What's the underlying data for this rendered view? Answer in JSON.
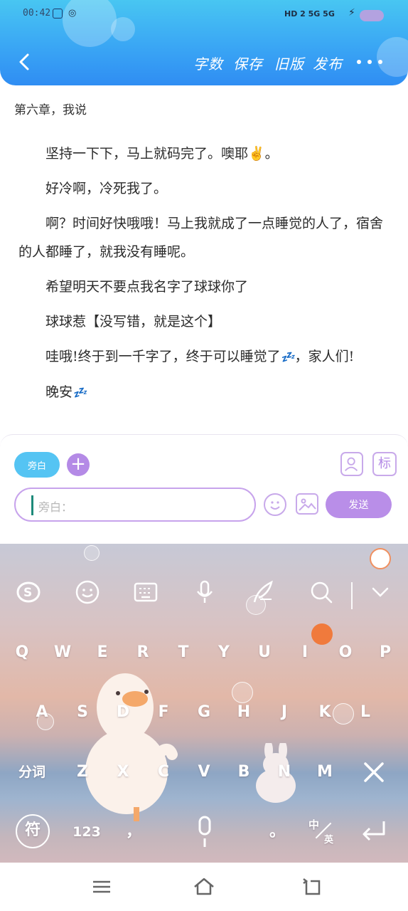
{
  "status_bar": {
    "time": "00:42",
    "network": "HD 2 5G 5G"
  },
  "toolbar": {
    "back_icon": "chevron-left-icon",
    "word_count": "字数",
    "save": "保存",
    "old_version": "旧版",
    "publish": "发布",
    "more_icon": "more-horizontal-icon"
  },
  "chapter": {
    "title": "第六章，我说",
    "paragraphs": [
      "坚持一下下，马上就码完了。噢耶✌️。",
      "好冷啊，冷死我了。",
      "啊？时间好快哦哦！马上我就成了一点睡觉的人了，宿舍的人都睡了，就我没有睡呢。",
      "希望明天不要点我名字了球球你了",
      "球球惹【没写错，就是这个】",
      "哇哦!终于到一千字了，终于可以睡觉了",
      "晚安"
    ],
    "p6_tail": "，家人们!",
    "zzz": "💤"
  },
  "input_panel": {
    "aside_chip": "旁白",
    "add_icon": "plus-icon",
    "avatar_icon": "user-card-icon",
    "mark_label": "标",
    "placeholder": "旁白：",
    "emoji_icon": "smile-icon",
    "image_icon": "image-icon",
    "send_label": "发送"
  },
  "keyboard": {
    "toolbar_icons": [
      "sogou-logo-icon",
      "emoji-icon",
      "keyboard-icon",
      "microphone-icon",
      "skin-quill-icon",
      "search-icon",
      "collapse-down-icon"
    ],
    "row1": [
      "Q",
      "W",
      "E",
      "R",
      "T",
      "Y",
      "U",
      "I",
      "O",
      "P"
    ],
    "row2": [
      "A",
      "S",
      "D",
      "F",
      "G",
      "H",
      "J",
      "K",
      "L"
    ],
    "row3_left": "分词",
    "row3": [
      "Z",
      "X",
      "C",
      "V",
      "B",
      "N",
      "M"
    ],
    "symbol_key": "符",
    "number_key": "123",
    "comma_key": "，",
    "period_key": "。",
    "lang_zh": "中",
    "lang_en": "英"
  },
  "nav_bar": {
    "icons": [
      "menu-icon",
      "home-icon",
      "back-icon"
    ]
  }
}
